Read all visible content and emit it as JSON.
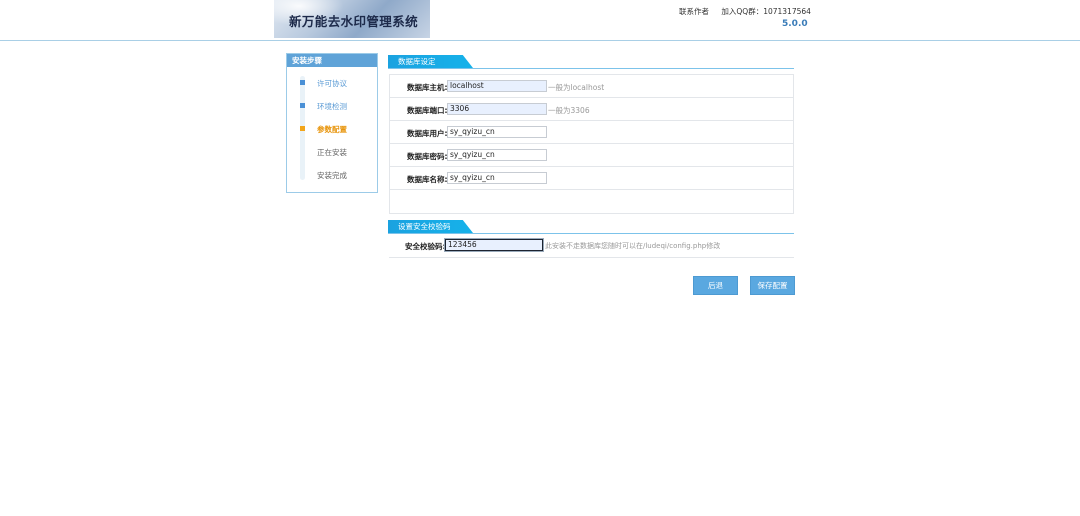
{
  "header": {
    "app_title": "新万能去水印管理系统",
    "contact_link": "联系作者",
    "qq_link": "加入QQ群：1071317564",
    "version": "5.0.0"
  },
  "sidebar": {
    "title": "安装步骤",
    "steps": [
      {
        "label": "许可协议",
        "state": "done"
      },
      {
        "label": "环境检测",
        "state": "done"
      },
      {
        "label": "参数配置",
        "state": "current"
      },
      {
        "label": "正在安装",
        "state": "todo"
      },
      {
        "label": "安装完成",
        "state": "todo"
      }
    ]
  },
  "db_section": {
    "title": "数据库设定",
    "fields": [
      {
        "label": "数据库主机:",
        "value": "localhost",
        "hint": "一般为localhost"
      },
      {
        "label": "数据库端口:",
        "value": "3306",
        "hint": "一般为3306"
      },
      {
        "label": "数据库用户:",
        "value": "sy_qyizu_cn",
        "hint": ""
      },
      {
        "label": "数据库密码:",
        "value": "sy_qyizu_cn",
        "hint": ""
      },
      {
        "label": "数据库名称:",
        "value": "sy_qyizu_cn",
        "hint": ""
      }
    ]
  },
  "security_section": {
    "title": "设置安全校验码",
    "label": "安全校验码:",
    "value": "123456",
    "hint": "此安装不走数据库您随时可以在/ludeqi/config.php修改"
  },
  "buttons": {
    "back": "后退",
    "save": "保存配置"
  },
  "colors": {
    "accent_blue": "#16a7e6",
    "button_blue": "#5aa8e0",
    "current_step": "#e8960f"
  }
}
